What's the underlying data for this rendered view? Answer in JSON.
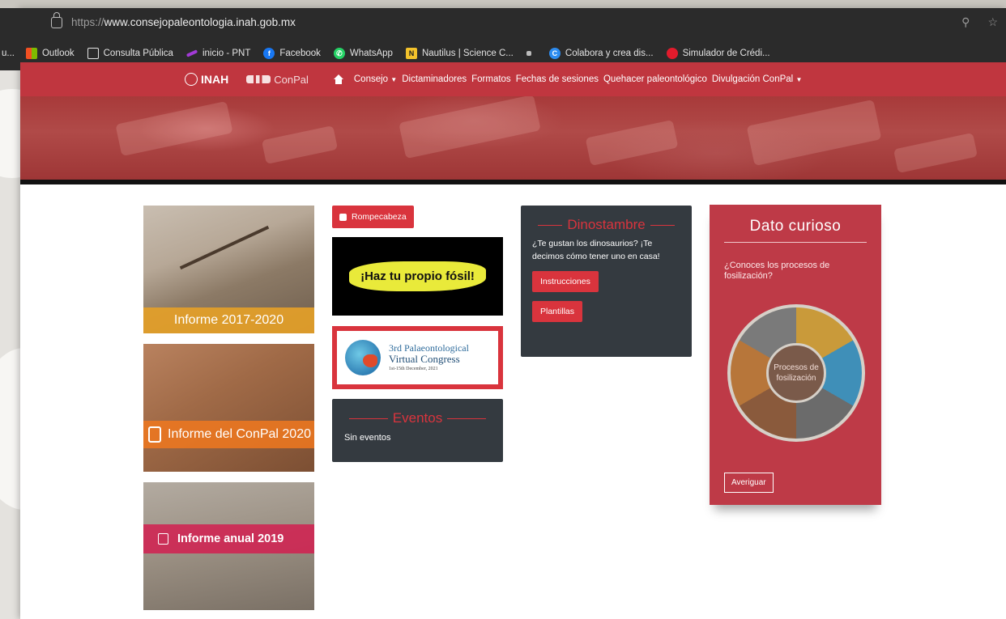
{
  "browser": {
    "url_proto": "https://",
    "url_rest": "www.consejopaleontologia.inah.gob.mx",
    "bookmarks": [
      {
        "label": "u...",
        "icon": "none-icon"
      },
      {
        "label": "Outlook",
        "icon": "windows-logo-icon",
        "color": "#f25022"
      },
      {
        "label": "Consulta Pública",
        "icon": "page-icon",
        "color": "#e3e3e3"
      },
      {
        "label": "inicio - PNT",
        "icon": "pnt-icon",
        "color": "#a23ad6"
      },
      {
        "label": "Facebook",
        "icon": "facebook-icon",
        "color": "#1877f2"
      },
      {
        "label": "WhatsApp",
        "icon": "whatsapp-icon",
        "color": "#25d366"
      },
      {
        "label": "Nautilus | Science C...",
        "icon": "nautilus-icon",
        "color": "#f3c22b"
      },
      {
        "label": "",
        "icon": "square-icon",
        "color": "#bbbbbb"
      },
      {
        "label": "Colabora y crea dis...",
        "icon": "canva-icon",
        "color": "#2d8cf0"
      },
      {
        "label": "Simulador de Crédi...",
        "icon": "red-circle-icon",
        "color": "#e21b2c"
      }
    ]
  },
  "nav": {
    "logo_inah": "INAH",
    "logo_conpal": "ConPal",
    "links": [
      "Consejo",
      "Dictaminadores",
      "Formatos",
      "Fechas de sesiones",
      "Quehacer paleontológico",
      "Divulgación ConPal"
    ],
    "dropdown_links": [
      "Consejo",
      "Divulgación ConPal"
    ]
  },
  "reports": {
    "r1": "Informe 2017-2020",
    "r2": "Informe del ConPal 2020",
    "r3": "Informe anual 2019"
  },
  "middle": {
    "puzzle_button": "Rompecabeza",
    "fossil_banner": "¡Haz tu propio fósil!",
    "congress_line1": "3rd Palaeontological",
    "congress_line2": "Virtual Congress",
    "congress_line3": "1st-15th December, 2021",
    "events_title": "Eventos",
    "events_empty": "Sin eventos"
  },
  "dino": {
    "title": "Dinostambre",
    "text": "¿Te gustan los dinosaurios? ¡Te decimos cómo tener uno en casa!",
    "btn_instructions": "Instrucciones",
    "btn_templates": "Plantillas"
  },
  "curious": {
    "title": "Dato curioso",
    "question": "¿Conoces los procesos de fosilización?",
    "wheel_center": "Procesos de fosilización",
    "button": "Averiguar"
  },
  "colors": {
    "brand_red": "#c0363f",
    "button_red": "#d9343d",
    "dark_card": "#343a40",
    "curious_card": "#be3a47"
  }
}
